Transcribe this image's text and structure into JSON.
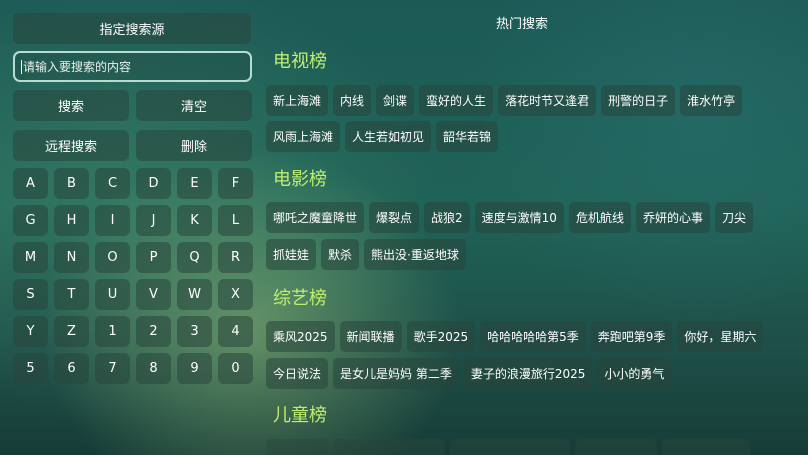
{
  "left_panel": {
    "search_source_label": "指定搜索源",
    "search_placeholder": "请输入要搜索的内容",
    "search_label": "搜索",
    "clear_label": "清空",
    "remote_search_label": "远程搜索",
    "delete_label": "删除",
    "keys": [
      "A",
      "B",
      "C",
      "D",
      "E",
      "F",
      "G",
      "H",
      "I",
      "J",
      "K",
      "L",
      "M",
      "N",
      "O",
      "P",
      "Q",
      "R",
      "S",
      "T",
      "U",
      "V",
      "W",
      "X",
      "Y",
      "Z",
      "1",
      "2",
      "3",
      "4",
      "5",
      "6",
      "7",
      "8",
      "9",
      "0"
    ]
  },
  "hot_search": {
    "title": "热门搜索",
    "sections": [
      {
        "title": "电视榜",
        "rows": [
          [
            "新上海滩",
            "内线",
            "剑谍",
            "蛮好的人生",
            "落花时节又逢君",
            "刑警的日子",
            "淮水竹亭"
          ],
          [
            "风雨上海滩",
            "人生若如初见",
            "韶华若锦"
          ]
        ]
      },
      {
        "title": "电影榜",
        "rows": [
          [
            "哪吒之魔童降世",
            "爆裂点",
            "战狼2",
            "速度与激情10",
            "危机航线",
            "乔妍的心事",
            "刀尖"
          ],
          [
            "抓娃娃",
            "默杀",
            "熊出没·重返地球"
          ]
        ]
      },
      {
        "title": "综艺榜",
        "rows": [
          [
            "乘风2025",
            "新闻联播",
            "歌手2025",
            "哈哈哈哈哈第5季",
            "奔跑吧第9季",
            "你好，星期六"
          ],
          [
            "今日说法",
            "是女儿是妈妈 第二季",
            "妻子的浪漫旅行2025",
            "小小的勇气"
          ]
        ]
      },
      {
        "title": "儿童榜",
        "rows": []
      }
    ]
  }
}
